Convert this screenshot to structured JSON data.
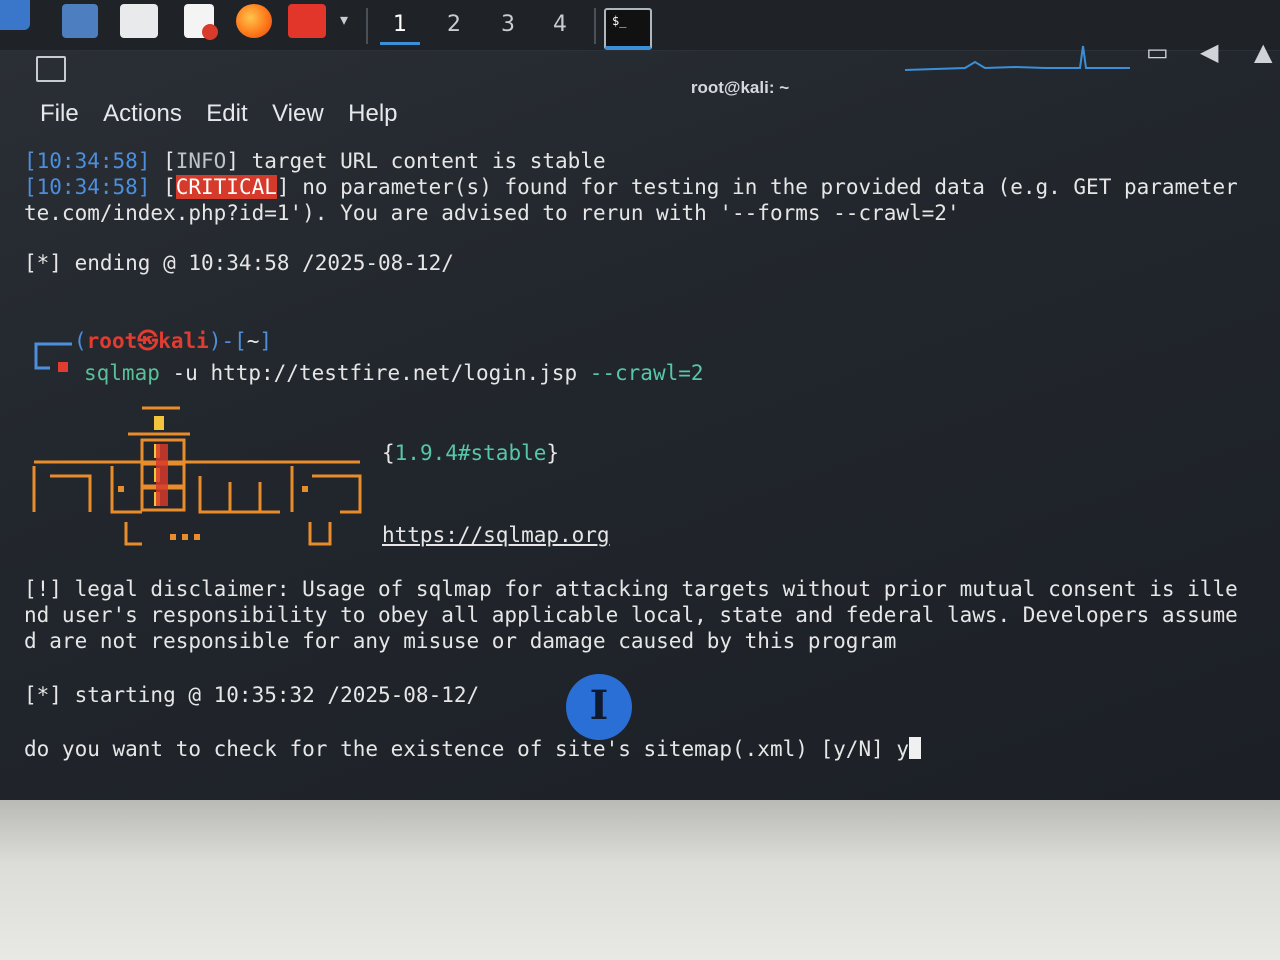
{
  "taskbar": {
    "workspaces": [
      "1",
      "2",
      "3",
      "4"
    ],
    "active_workspace": "1",
    "icons": [
      "kali-menu-icon",
      "desktop-icon",
      "file-manager-icon",
      "text-editor-icon",
      "firefox-icon",
      "terminal-red-icon",
      "chevron-down-icon"
    ],
    "tray_icons": [
      "display-icon",
      "volume-icon",
      "notification-bell-icon"
    ]
  },
  "window": {
    "title": "root@kali: ~",
    "menu": [
      "File",
      "Actions",
      "Edit",
      "View",
      "Help"
    ]
  },
  "terminal": {
    "l1": {
      "time": "[10:34:58]",
      "tag_open": " [",
      "tag": "INFO",
      "tag_close": "] ",
      "msg": "target URL content is stable"
    },
    "l2": {
      "time": "[10:34:58]",
      "tag_open": " [",
      "tag": "CRITICAL",
      "tag_close": "] ",
      "msg": "no parameter(s) found for testing in the provided data (e.g. GET parameter"
    },
    "l3": {
      "a": "te.com/index.php?id=1'). You are advised to rerun with '",
      "b": "--forms --crawl=2",
      "c": "'"
    },
    "l4": "[*] ending @ 10:34:58 /2025-08-12/",
    "prompt": {
      "open": "(",
      "user": "root",
      "at": "㉿",
      "host": "kali",
      "close": ")-[",
      "dir": "~",
      "end": "]"
    },
    "command": {
      "cmd": "sqlmap",
      "flag": " -u ",
      "url": "http://testfire.net/login.jsp",
      "opt": " --crawl=2"
    },
    "version": {
      "open": "{",
      "ver": "1.9.4#stable",
      "close": "}"
    },
    "site": "https://sqlmap.org",
    "disclaimer": [
      "[!] legal disclaimer: Usage of sqlmap for attacking targets without prior mutual consent is ille",
      "nd user's responsibility to obey all applicable local, state and federal laws. Developers assume",
      "d are not responsible for any misuse or damage caused by this program"
    ],
    "starting": "[*] starting @ 10:35:32 /2025-08-12/",
    "question": "do you want to check for the existence of site's sitemap(.xml) [y/N] ",
    "answer": "y"
  },
  "colors": {
    "critical_bg": "#d63a2a",
    "prompt_blue": "#4d8fdc",
    "prompt_red": "#e03c31",
    "option_green": "#56c7a8",
    "logo_orange": "#e98c2b",
    "logo_yellow": "#f3c53c"
  }
}
